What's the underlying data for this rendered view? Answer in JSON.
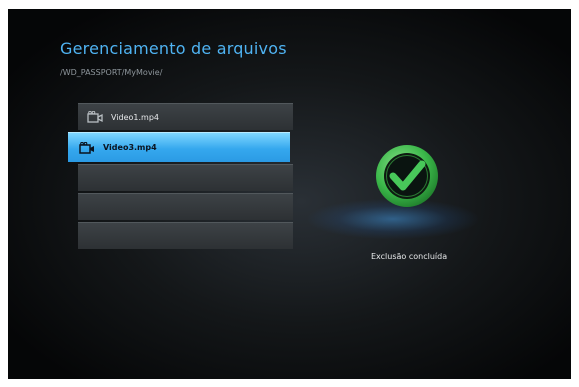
{
  "header": {
    "title": "Gerenciamento de arquivos",
    "path": "/WD_PASSPORT/MyMovie/"
  },
  "file_list": {
    "items": [
      {
        "name": "Video1.mp4",
        "selected": false,
        "icon": "video-camera-icon"
      },
      {
        "name": "Video3.mp4",
        "selected": true,
        "icon": "video-camera-icon"
      },
      {
        "name": "",
        "selected": false
      },
      {
        "name": "",
        "selected": false
      },
      {
        "name": "",
        "selected": false
      }
    ]
  },
  "status": {
    "icon": "checkmark-icon",
    "message": "Exclusão concluída"
  },
  "colors": {
    "accent": "#4fb3f2",
    "selected_row": "#35a8ee",
    "success": "#39b54a"
  }
}
